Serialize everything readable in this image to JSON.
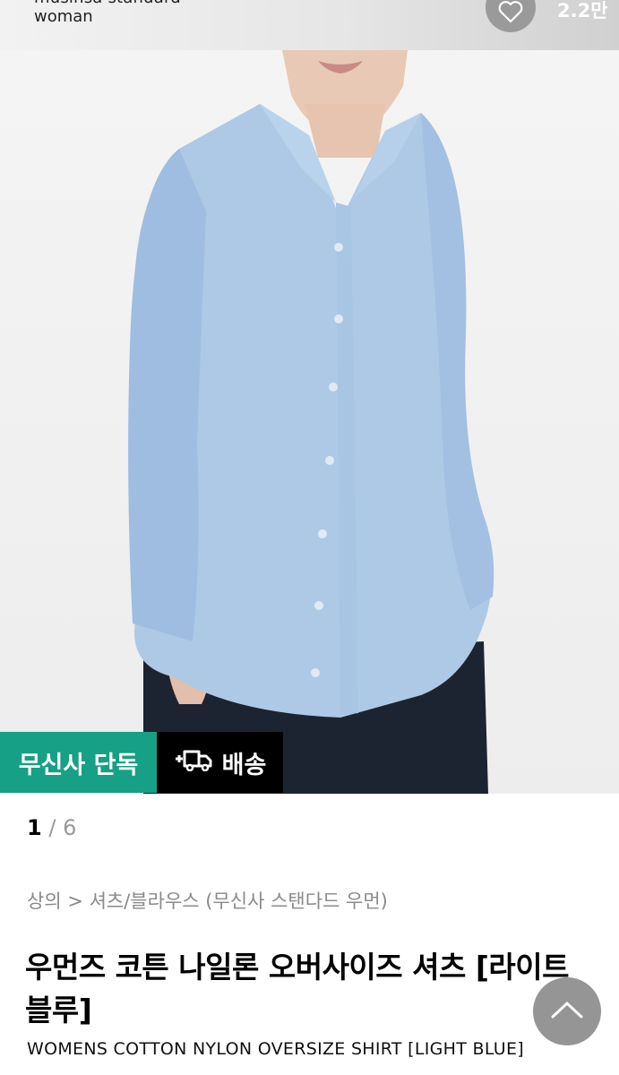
{
  "brand": {
    "name_line1": "musinsa standard",
    "name_line2": "woman"
  },
  "likes": {
    "count": "2.2만",
    "icon": "heart-icon"
  },
  "badges": {
    "exclusive": "무신사 단독",
    "shipping": "배송",
    "shipping_icon": "truck-plus-icon",
    "exclusive_color": "#16a085"
  },
  "gallery": {
    "current": "1",
    "separator": "/",
    "total": "6"
  },
  "breadcrumb": "상의 > 셔츠/블라우스 (무신사 스탠다드 우먼)",
  "product": {
    "title": "우먼즈 코튼 나일론 오버사이즈 셔츠 [라이트 블루]",
    "subtitle": "WOMENS COTTON NYLON OVERSIZE SHIRT [LIGHT BLUE]"
  },
  "scroll_top_icon": "chevron-up-icon"
}
